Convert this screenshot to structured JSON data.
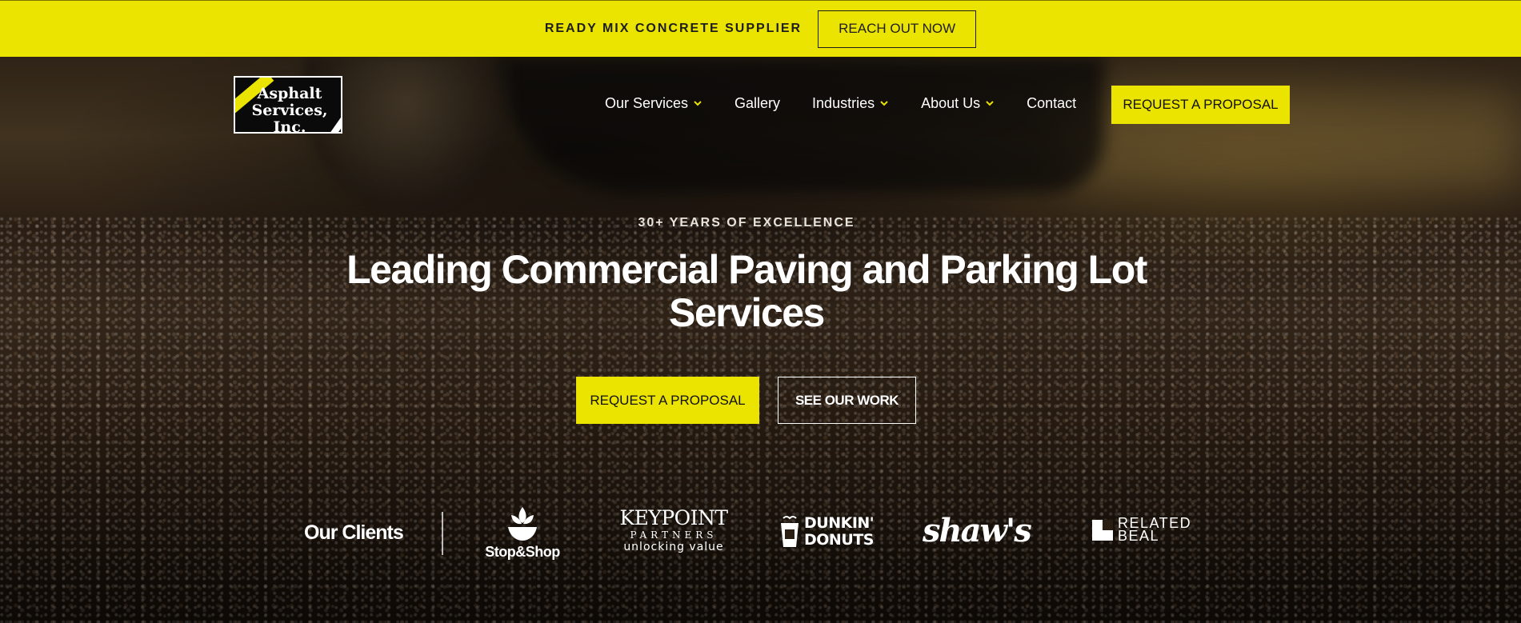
{
  "topbar": {
    "text": "READY MIX CONCRETE SUPPLIER",
    "button_label": "REACH OUT NOW"
  },
  "nav": {
    "logo_text_line1": "Asphalt",
    "logo_text_line2": "Services, Inc.",
    "items": [
      {
        "label": "Our Services",
        "has_dropdown": true,
        "icon": "chevron-down-icon"
      },
      {
        "label": "Gallery",
        "has_dropdown": false
      },
      {
        "label": "Industries",
        "has_dropdown": true,
        "icon": "chevron-down-icon"
      },
      {
        "label": "About Us",
        "has_dropdown": true,
        "icon": "chevron-down-icon"
      },
      {
        "label": "Contact",
        "has_dropdown": false
      }
    ],
    "cta_label": "REQUEST A PROPOSAL"
  },
  "hero": {
    "eyebrow": "30+ YEARS OF EXCELLENCE",
    "headline": "Leading Commercial Paving and Parking Lot Services",
    "primary_button": "REQUEST A PROPOSAL",
    "secondary_button": "SEE OUR WORK"
  },
  "clients": {
    "label": "Our Clients",
    "logos": {
      "stopshop": "Stop&Shop",
      "keypoint_line1": "KEYPOINT",
      "keypoint_line2": "PARTNERS",
      "keypoint_line3": "unlocking value",
      "dunkin_line1": "DUNKIN'",
      "dunkin_line2": "DONUTS",
      "shaws": "shaw's",
      "related_line1": "RELATED",
      "related_line2": "BEAL"
    }
  },
  "colors": {
    "accent": "#ebe300",
    "text_dark": "#1d1d1d",
    "text_light": "#ffffff"
  }
}
